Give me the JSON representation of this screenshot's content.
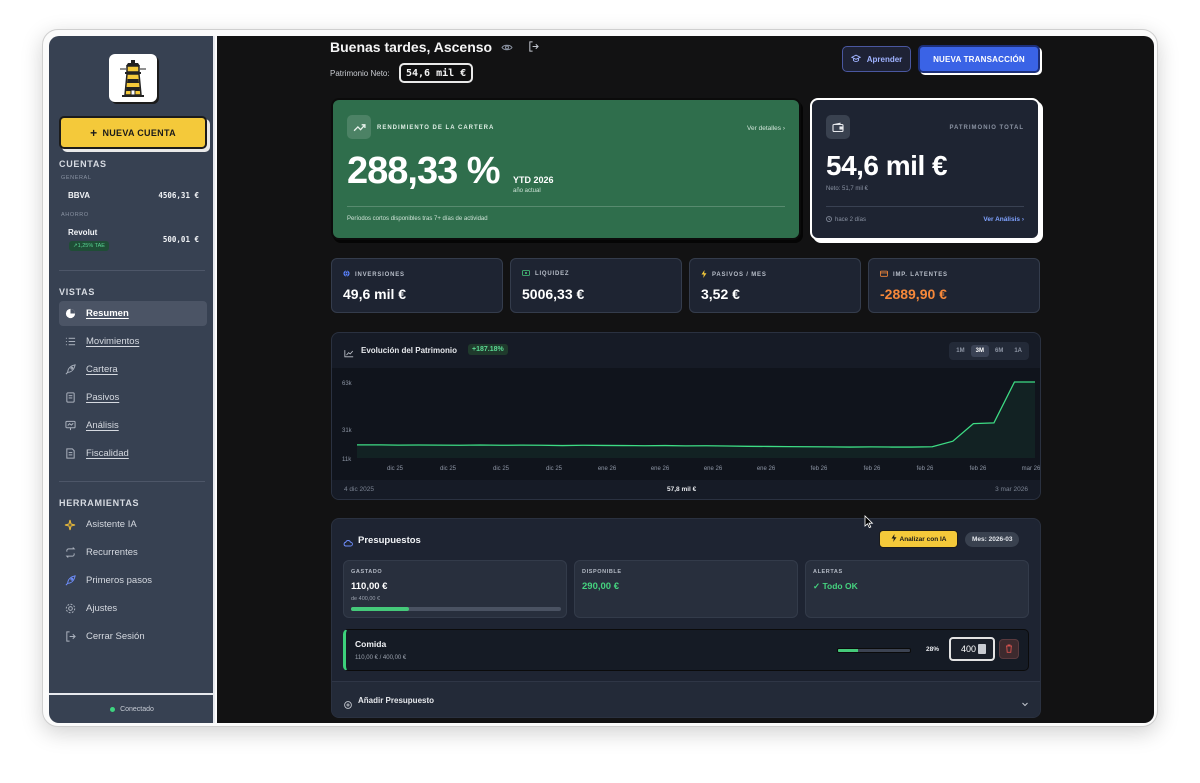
{
  "sidebar": {
    "new_account_label": "NUEVA CUENTA",
    "accounts_title": "CUENTAS",
    "groups": [
      {
        "label": "GENERAL",
        "accounts": [
          {
            "name": "BBVA",
            "value": "4506,31 €"
          }
        ]
      },
      {
        "label": "AHORRO",
        "accounts": [
          {
            "name": "Revolut",
            "value": "500,01 €",
            "badge": "↗1,25% TAE"
          }
        ]
      }
    ],
    "views_title": "VISTAS",
    "views": [
      {
        "label": "Resumen",
        "icon": "pie-chart-icon",
        "active": true
      },
      {
        "label": "Movimientos",
        "icon": "list-icon"
      },
      {
        "label": "Cartera",
        "icon": "rocket-icon"
      },
      {
        "label": "Pasivos",
        "icon": "receipt-icon"
      },
      {
        "label": "Análisis",
        "icon": "presentation-icon"
      },
      {
        "label": "Fiscalidad",
        "icon": "document-icon"
      }
    ],
    "tools_title": "HERRAMIENTAS",
    "tools": [
      {
        "label": "Asistente IA",
        "icon": "sparkle-icon"
      },
      {
        "label": "Recurrentes",
        "icon": "repeat-icon"
      },
      {
        "label": "Primeros pasos",
        "icon": "rocket-icon"
      },
      {
        "label": "Ajustes",
        "icon": "gear-icon"
      },
      {
        "label": "Cerrar Sesión",
        "icon": "logout-icon"
      }
    ],
    "status": "Conectado",
    "colors": {
      "bg": "#374152",
      "accent": "#f4c93a",
      "status_dot": "#3dd47f"
    }
  },
  "header": {
    "greeting": "Buenas tardes, Ascenso",
    "net_worth_label": "Patrimonio Neto:",
    "net_worth_value": "54,6 mil €",
    "learn_label": "Aprender",
    "new_transaction_label": "NUEVA TRANSACCIÓN"
  },
  "performance": {
    "title": "RENDIMIENTO DE LA CARTERA",
    "link": "Ver detalles",
    "value": "288,33 %",
    "period": "YTD 2026",
    "period_sub": "año actual",
    "footnote": "Períodos cortos disponibles tras 7+ días de actividad",
    "color": "#2f6e4c"
  },
  "total": {
    "title": "PATRIMONIO TOTAL",
    "value": "54,6 mil €",
    "sub": "Neto: 51,7 mil €",
    "updated": "hace 2 días",
    "link": "Ver Análisis"
  },
  "stats": [
    {
      "label": "INVERSIONES",
      "value": "49,6 mil €",
      "icon": "globe-icon"
    },
    {
      "label": "LIQUIDEZ",
      "value": "5006,33 €",
      "icon": "cash-icon"
    },
    {
      "label": "PASIVOS / MES",
      "value": "3,52 €",
      "icon": "bolt-icon"
    },
    {
      "label": "IMP. LATENTES",
      "value": "-2889,90 €",
      "icon": "wallet-icon"
    }
  ],
  "chart": {
    "title": "Evolución del Patrimonio",
    "change": "+187.18%",
    "ranges": [
      "1M",
      "3M",
      "6M",
      "1A"
    ],
    "active_range": "3M",
    "start_date": "4 dic 2025",
    "hover_value": "57,8 mil €",
    "end_date": "3 mar 2026"
  },
  "chart_data": {
    "type": "area",
    "title": "Evolución del Patrimonio",
    "x": [
      "dic 25",
      "dic 25",
      "dic 25",
      "dic 25",
      "ene 26",
      "ene 26",
      "ene 26",
      "ene 26",
      "feb 26",
      "feb 26",
      "feb 26",
      "feb 26",
      "mar 26"
    ],
    "y_ticks": [
      "63k",
      "31k",
      "11k"
    ],
    "ylim": [
      11000,
      63000
    ],
    "series": [
      {
        "values": [
          20000,
          20000,
          19800,
          19900,
          19800,
          19700,
          19900,
          19700,
          19800,
          19700,
          19500,
          19700,
          19600,
          19500,
          19400,
          19500,
          19300,
          19400,
          19200,
          19000,
          18900,
          18800,
          18700,
          18600,
          18500,
          18600,
          18500,
          18500,
          18700,
          22500,
          34500,
          35000,
          63000,
          63000
        ]
      }
    ],
    "line_color": "#3ddc84",
    "grid": false
  },
  "budgets": {
    "title": "Presupuestos",
    "ai_button": "Analizar con IA",
    "month_label": "Mes: 2026-03",
    "spent_label": "GASTADO",
    "spent_value": "110,00 €",
    "spent_sub": "de 400,00 €",
    "spent_fraction": 0.275,
    "available_label": "DISPONIBLE",
    "available_value": "290,00 €",
    "alerts_label": "ALERTAS",
    "alerts_value": "✓ Todo OK",
    "items": [
      {
        "name": "Comida",
        "amount": "110,00 € / 400,00 €",
        "percent": "28%",
        "fraction": 0.28,
        "limit_input": "400"
      }
    ],
    "add_label": "Añadir Presupuesto"
  }
}
